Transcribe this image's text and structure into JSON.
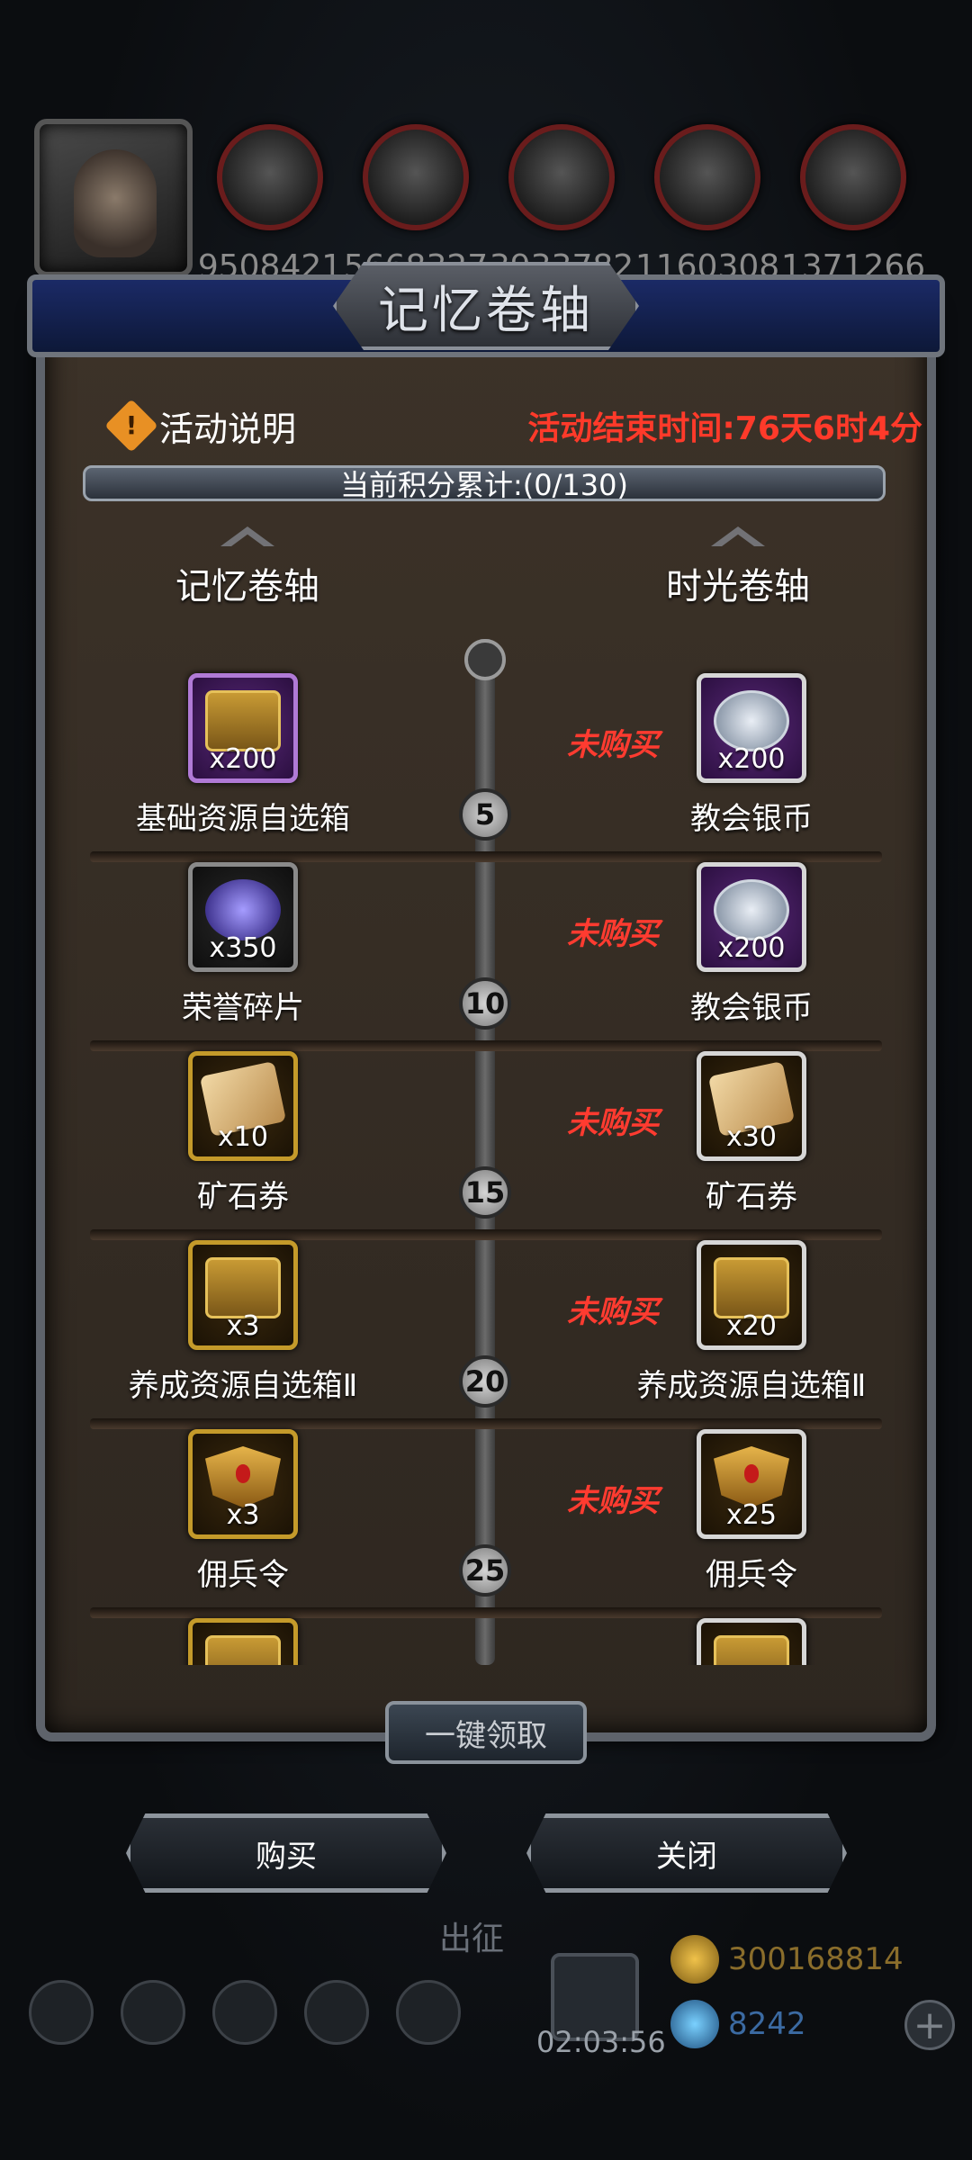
{
  "resources": [
    {
      "value": "9508421",
      "icon": "wood-log-icon"
    },
    {
      "value": "5668327",
      "icon": "plank-icon"
    },
    {
      "value": "3933782",
      "icon": "iron-ingot-icon"
    },
    {
      "value": "1160308",
      "icon": "crystal-icon"
    },
    {
      "value": "1371266",
      "icon": "stone-icon"
    }
  ],
  "panel": {
    "title": "记忆卷轴",
    "info_label": "活动说明",
    "info_icon_glyph": "!",
    "countdown": "活动结束时间:76天6时4分",
    "score": "当前积分累计:(0/130)",
    "col_left": "记忆卷轴",
    "col_right": "时光卷轴"
  },
  "rows": [
    {
      "node": "5",
      "status": "未购买",
      "left": {
        "name": "基础资源自选箱",
        "qty": "x200",
        "frame": "purple",
        "glyph": "chest"
      },
      "right": {
        "name": "教会银币",
        "qty": "x200",
        "frame": "purple",
        "glyph": "coin"
      }
    },
    {
      "node": "10",
      "status": "未购买",
      "left": {
        "name": "荣誉碎片",
        "qty": "x350",
        "frame": "dark",
        "glyph": "shard"
      },
      "right": {
        "name": "教会银币",
        "qty": "x200",
        "frame": "purple",
        "glyph": "coin"
      }
    },
    {
      "node": "15",
      "status": "未购买",
      "left": {
        "name": "矿石券",
        "qty": "x10",
        "frame": "gold",
        "glyph": "scroll"
      },
      "right": {
        "name": "矿石券",
        "qty": "x30",
        "frame": "gold",
        "glyph": "scroll"
      }
    },
    {
      "node": "20",
      "status": "未购买",
      "left": {
        "name": "养成资源自选箱Ⅱ",
        "qty": "x3",
        "frame": "gold",
        "glyph": "chest"
      },
      "right": {
        "name": "养成资源自选箱Ⅱ",
        "qty": "x20",
        "frame": "gold",
        "glyph": "chest"
      }
    },
    {
      "node": "25",
      "status": "未购买",
      "left": {
        "name": "佣兵令",
        "qty": "x3",
        "frame": "gold",
        "glyph": "shield"
      },
      "right": {
        "name": "佣兵令",
        "qty": "x25",
        "frame": "gold",
        "glyph": "shield"
      }
    }
  ],
  "buttons": {
    "claim_all": "一键领取",
    "buy": "购买",
    "close": "关闭"
  },
  "hud": {
    "expedition": "出征",
    "gift_timer": "02:03:56",
    "gold": "300168814",
    "gems": "8242",
    "plus": "+"
  },
  "colors": {
    "countdown": "#ff3a2a",
    "not_purchased": "#ff3b30",
    "panel_blue": "#1b2a66"
  }
}
